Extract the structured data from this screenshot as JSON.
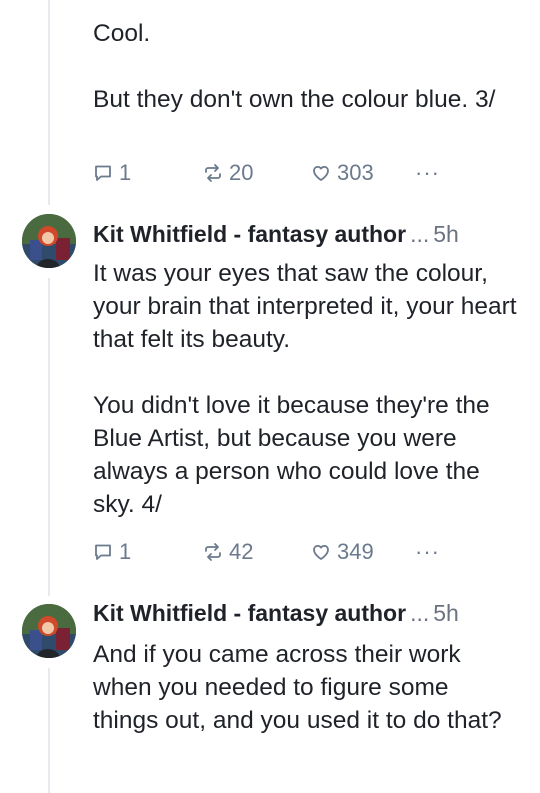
{
  "posts": [
    {
      "text": "Cool.\n\nBut they don't own the colour blue. 3/",
      "actions": {
        "replies": "1",
        "reposts": "20",
        "likes": "303",
        "more": "···"
      }
    },
    {
      "author": "Kit Whitfield - fantasy author",
      "ellipsis": "...",
      "time": "5h",
      "text": "It was your eyes that saw the colour, your brain that interpreted it, your heart that felt its beauty.\n\nYou didn't love it because they're the Blue Artist, but because you were always a person who could love the sky. 4/",
      "actions": {
        "replies": "1",
        "reposts": "42",
        "likes": "349",
        "more": "···"
      }
    },
    {
      "author": "Kit Whitfield - fantasy author",
      "ellipsis": "...",
      "time": "5h",
      "text": "And if you came across their work when you needed to figure some things out, and you used it to do that?"
    }
  ],
  "icons": {
    "reply": "speech-bubble-icon",
    "repost": "repost-arrows-icon",
    "like": "heart-icon",
    "more": "more-options-icon"
  },
  "colors": {
    "text": "#1f2329",
    "muted": "#6b7a8c",
    "thread_line": "#e6e9ee"
  }
}
